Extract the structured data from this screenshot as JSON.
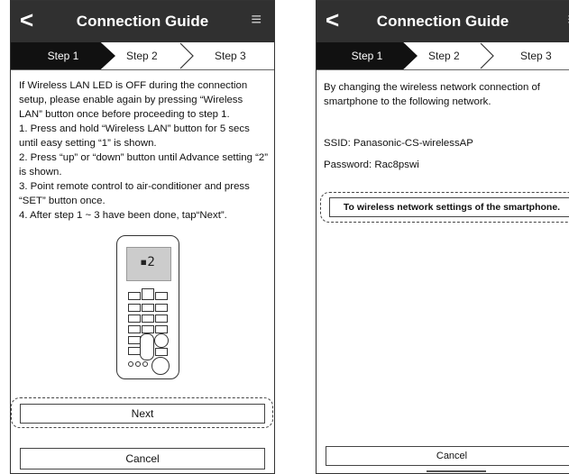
{
  "left": {
    "header": {
      "back": "<",
      "title": "Connection Guide",
      "menu": "≡"
    },
    "steps": [
      "Step 1",
      "Step 2",
      "Step 3"
    ],
    "instructions": [
      "If Wireless LAN LED is OFF during the connection setup, please enable again by pressing “Wireless LAN” button once  before proceeding to step 1.",
      "1. Press and hold “Wireless LAN”  button for 5 secs until easy setting “1” is shown.",
      "2. Press “up” or “down” button until Advance setting “2” is shown.",
      "3. Point  remote control to air-conditioner and press “SET” button once.",
      "4. After step 1 ~ 3 have been done, tap“Next”."
    ],
    "remote_display": "▪2",
    "next_label": "Next",
    "cancel_label": "Cancel"
  },
  "right": {
    "header": {
      "back": "<",
      "title": "Connection Guide",
      "menu": "≡"
    },
    "steps": [
      "Step 1",
      "Step 2",
      "Step 3"
    ],
    "intro": "By changing the wireless network connection of smartphone to the following network.",
    "ssid": "SSID: Panasonic-CS-wirelessAP",
    "password": "Password: Rac8pswi",
    "wireless_button_label": "To wireless network settings of the smartphone.",
    "cancel_label": "Cancel"
  }
}
